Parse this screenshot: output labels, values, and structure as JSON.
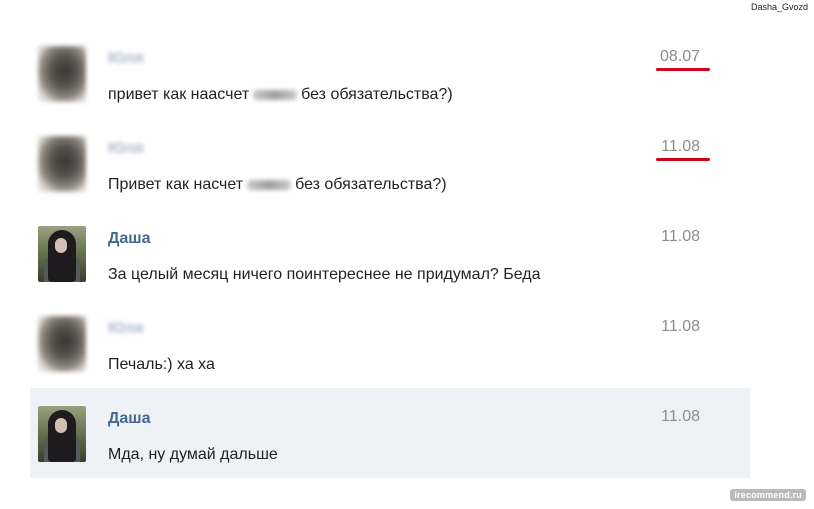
{
  "watermark": {
    "username": "Dasha_Gvozd",
    "site": "irecommend.ru"
  },
  "messages": [
    {
      "sender": "Юля",
      "sender_blurred": true,
      "date": "08.07",
      "date_marked": true,
      "text_before": "привет как наасчет",
      "text_after": "без обязательства?)",
      "has_censor": true,
      "highlight": false
    },
    {
      "sender": "Юля",
      "sender_blurred": true,
      "date": "11.08",
      "date_marked": true,
      "text_before": "Привет как насчет",
      "text_after": "без обязательства?)",
      "has_censor": true,
      "highlight": false
    },
    {
      "sender": "Даша",
      "sender_blurred": false,
      "date": "11.08",
      "date_marked": false,
      "text_before": "За целый месяц ничего поинтереснее не придумал? Беда",
      "text_after": "",
      "has_censor": false,
      "highlight": false
    },
    {
      "sender": "Юля",
      "sender_blurred": true,
      "date": "11.08",
      "date_marked": false,
      "text_before": "Печаль:) ха ха",
      "text_after": "",
      "has_censor": false,
      "highlight": false
    },
    {
      "sender": "Даша",
      "sender_blurred": false,
      "date": "11.08",
      "date_marked": false,
      "text_before": "Мда, ну думай дальше",
      "text_after": "",
      "has_censor": false,
      "highlight": true
    }
  ],
  "colors": {
    "name": "#45688e",
    "date": "#8c8c8c",
    "marker": "#d0021b",
    "highlight_bg": "#eef1f6"
  }
}
